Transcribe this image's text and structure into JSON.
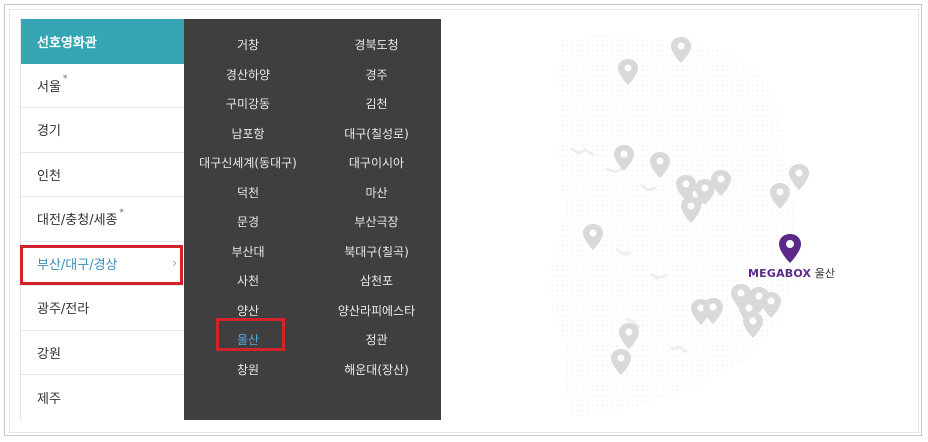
{
  "sidebar": {
    "items": [
      {
        "label": "선호영화관",
        "star": ""
      },
      {
        "label": "서울",
        "star": "*"
      },
      {
        "label": "경기",
        "star": ""
      },
      {
        "label": "인천",
        "star": ""
      },
      {
        "label": "대전/충청/세종",
        "star": "*"
      },
      {
        "label": "부산/대구/경상",
        "star": "",
        "chevron": "›"
      },
      {
        "label": "광주/전라",
        "star": ""
      },
      {
        "label": "강원",
        "star": ""
      },
      {
        "label": "제주",
        "star": ""
      }
    ]
  },
  "theaters": {
    "items": [
      "거창",
      "경북도청",
      "경산하양",
      "경주",
      "구미강동",
      "김천",
      "남포항",
      "대구(칠성로)",
      "대구신세계(동대구)",
      "대구이시아",
      "덕천",
      "마산",
      "문경",
      "부산극장",
      "부산대",
      "북대구(칠곡)",
      "사천",
      "삼천포",
      "양산",
      "양산라피에스타",
      "울산",
      "정관",
      "창원",
      "해운대(장산)"
    ]
  },
  "map": {
    "brand": "MEGABOX",
    "selected_theater": "울산",
    "accent_color": "#5b2a86",
    "pin_color": "#d9d9d9",
    "icon": "map-pin-icon"
  },
  "colors": {
    "active_tab": "#35a5b3",
    "panel_bg": "#3f3f3f",
    "highlight_box": "#d2232a",
    "selected_text": "#5aa7d8"
  }
}
